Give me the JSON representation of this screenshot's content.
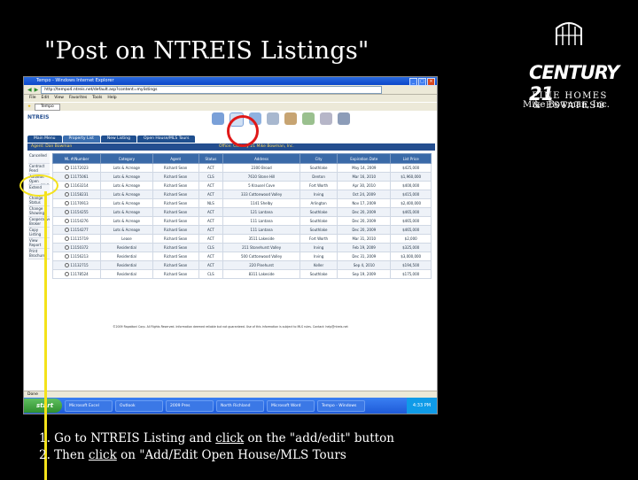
{
  "slide": {
    "title": "\"Post on NTREIS Listings\"",
    "brand": {
      "wordmark": "CENTURY 21",
      "line1": "FINE HOMES",
      "line2": "& ESTATES®",
      "company": "Mike Bowman, Inc."
    },
    "instructions": {
      "line1_prefix": "1. Go to NTREIS Listing and ",
      "line1_link": "click",
      "line1_suffix": " on the \"add/edit\" button",
      "line2_prefix": "2. Then ",
      "line2_link": "click",
      "line2_suffix": " on \"Add/Edit Open House/MLS Tours"
    }
  },
  "browser": {
    "window_title": "Tempo - Windows Internet Explorer",
    "address": "http://tempo4.ntreis.net/default.asp?content=mylistings",
    "menu": [
      "File",
      "Edit",
      "View",
      "Favorites",
      "Tools",
      "Help"
    ],
    "fav_tab": "Tempo",
    "status": "Done"
  },
  "page": {
    "logo": "NTREIS",
    "tabs": [
      "Main Menu",
      "Property List",
      "New Listing",
      "Open House/MLS Tours"
    ],
    "agent_label": "Agent: Dan Bowman",
    "office_label": "Office: Century 21 Mike Bowman, Inc.",
    "side_menu": [
      "Cancelled",
      "Contract Pend",
      "Add/Edit Open House/MLS Tours",
      "Extend",
      "Change Status",
      "Change Showing",
      "Cooperative Broker",
      "Copy Listing",
      "View Report",
      "Print Brochure"
    ],
    "columns": [
      "ML #/Number",
      "Category",
      "Agent",
      "Status",
      "Address",
      "City",
      "Expiration Date",
      "List Price"
    ],
    "rows": [
      [
        "11172023",
        "Lots & Acreage",
        "Richard Sean",
        "ACT",
        "2300 Broad",
        "Southlake",
        "May 14, 2009",
        "$425,000"
      ],
      [
        "11175061",
        "Lots & Acreage",
        "Richard Sean",
        "CLS",
        "7610 Stone Hill",
        "Denton",
        "Mar 16, 2010",
        "$1,960,000"
      ],
      [
        "11163214",
        "Lots & Acreage",
        "Richard Sean",
        "ACT",
        "5 Krausel Cove",
        "Fort Worth",
        "Apr 30, 2010",
        "$400,000"
      ],
      [
        "11158231",
        "Lots & Acreage",
        "Richard Sean",
        "ACT",
        "333 Cottonwood Valley",
        "Irving",
        "Oct 24, 2009",
        "$415,000"
      ],
      [
        "11170913",
        "Lots & Acreage",
        "Richard Sean",
        "NLS",
        "1141 Shelby",
        "Arlington",
        "Nov 17, 2009",
        "$2,400,000"
      ],
      [
        "11154255",
        "Lots & Acreage",
        "Richard Sean",
        "ACT",
        "121 Lantana",
        "Southlake",
        "Dec 20, 2009",
        "$465,000"
      ],
      [
        "11154276",
        "Lots & Acreage",
        "Richard Sean",
        "ACT",
        "111 Lantana",
        "Southlake",
        "Dec 20, 2009",
        "$465,000"
      ],
      [
        "11154277",
        "Lots & Acreage",
        "Richard Sean",
        "ACT",
        "111 Lantana",
        "Southlake",
        "Dec 20, 2009",
        "$465,000"
      ],
      [
        "11115719",
        "Lease",
        "Richard Sean",
        "ACT",
        "3511 Lakeside",
        "Fort Worth",
        "Mar 31, 2010",
        "$2,000"
      ],
      [
        "11150372",
        "Residential",
        "Richard Sean",
        "CLS",
        "211 Stonehurst Valley",
        "Irving",
        "Feb 19, 2009",
        "$325,000"
      ],
      [
        "11156213",
        "Residential",
        "Richard Sean",
        "ACT",
        "500 Cottonwood Valley",
        "Irving",
        "Dec 31, 2009",
        "$3,000,000"
      ],
      [
        "11132715",
        "Residential",
        "Richard Sean",
        "ACT",
        "220 Pinehurst",
        "Keller",
        "Sep 4, 2010",
        "$194,500"
      ],
      [
        "11178524",
        "Residential",
        "Richard Sean",
        "CLS",
        "8311 Lakeside",
        "Southlake",
        "Sep 19, 2009",
        "$175,000"
      ]
    ],
    "footnote": "©2009 Rapattoni Corp. All Rights Reserved. Information deemed reliable but not guaranteed. Use of this information is subject to MLS rules. Contact: help@ntreis.net"
  },
  "taskbar": {
    "start": "start",
    "items": [
      "Microsoft Excel",
      "Outlook",
      "2009 Pres",
      "North Richland",
      "Microsoft Word",
      "Tempo - Windows"
    ],
    "clock": "4:33 PM"
  },
  "colors": {
    "annotation_red": "#e01818",
    "annotation_yellow": "#f4e21a",
    "ntreis_blue": "#244e8f"
  }
}
